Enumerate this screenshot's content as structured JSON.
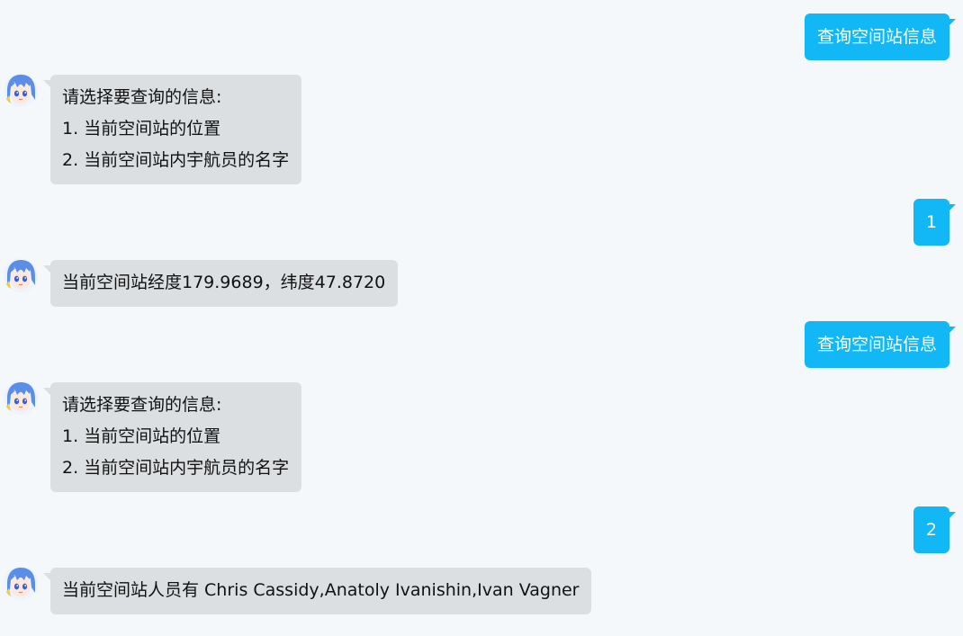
{
  "messages": [
    {
      "from": "user",
      "text": "查询空间站信息"
    },
    {
      "from": "bot",
      "lines": [
        "请选择要查询的信息:",
        "1. 当前空间站的位置",
        "2. 当前空间站内宇航员的名字"
      ]
    },
    {
      "from": "user",
      "text": "1"
    },
    {
      "from": "bot",
      "lines": [
        "当前空间站经度179.9689，纬度47.8720"
      ]
    },
    {
      "from": "user",
      "text": "查询空间站信息"
    },
    {
      "from": "bot",
      "lines": [
        "请选择要查询的信息:",
        "1. 当前空间站的位置",
        "2. 当前空间站内宇航员的名字"
      ]
    },
    {
      "from": "user",
      "text": "2"
    },
    {
      "from": "bot",
      "lines": [
        "当前空间站人员有 Chris Cassidy,Anatoly Ivanishin,Ivan Vagner"
      ]
    }
  ],
  "colors": {
    "page_bg": "#f5f8fb",
    "user_bubble": "#12b7f5",
    "bot_bubble": "#dcdfe2",
    "avatar_hair": "#5b8ee6"
  },
  "icons": {
    "bot_avatar": "anime-avatar-icon"
  }
}
